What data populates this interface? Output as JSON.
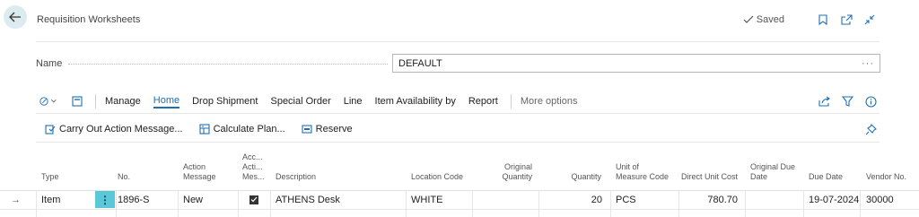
{
  "header": {
    "title": "Requisition Worksheets",
    "saved_label": "Saved"
  },
  "name_field": {
    "label": "Name",
    "value": "DEFAULT",
    "more": "···"
  },
  "action_bar": {
    "items": [
      "Manage",
      "Home",
      "Drop Shipment",
      "Special Order",
      "Line",
      "Item Availability by",
      "Report"
    ],
    "active": "Home",
    "more": "More options"
  },
  "sub_actions": [
    "Carry Out Action Message...",
    "Calculate Plan...",
    "Reserve"
  ],
  "grid": {
    "headers": {
      "type": "Type",
      "no": "No.",
      "action_message": [
        "Action",
        "Message"
      ],
      "acc_action_message": [
        "Acc...",
        "Acti...",
        "Mes..."
      ],
      "description": "Description",
      "location_code": "Location Code",
      "original_quantity": [
        "Original",
        "Quantity"
      ],
      "quantity": "Quantity",
      "uom": [
        "Unit of",
        "Measure Code"
      ],
      "direct_unit_cost": "Direct Unit Cost",
      "original_due_date": [
        "Original Due",
        "Date"
      ],
      "due_date": "Due Date",
      "vendor_no": "Vendor No."
    },
    "rows": [
      {
        "indicator": "→",
        "type": "Item",
        "no": "1896-S",
        "action_message": "New",
        "accept": true,
        "description": "ATHENS Desk",
        "location_code": "WHITE",
        "original_quantity": "",
        "quantity": "20",
        "uom": "PCS",
        "direct_unit_cost": "780.70",
        "original_due_date": "",
        "due_date": "19-07-2024",
        "vendor_no": "30000"
      }
    ]
  },
  "icons": {
    "back": "back-arrow-icon",
    "saved": "checkmark-icon",
    "bookmark": "bookmark-icon",
    "open_new": "open-new-window-icon",
    "collapse": "collapse-icon",
    "edit_list": "edit-list-icon",
    "new_doc": "new-document-icon",
    "share": "share-icon",
    "filter": "filter-icon",
    "info": "info-icon",
    "personalize": "personalize-pin-icon"
  },
  "colors": {
    "accent": "#1f6fb2",
    "row_action": "#5bc8d8",
    "back_bg": "#dcebf0"
  }
}
